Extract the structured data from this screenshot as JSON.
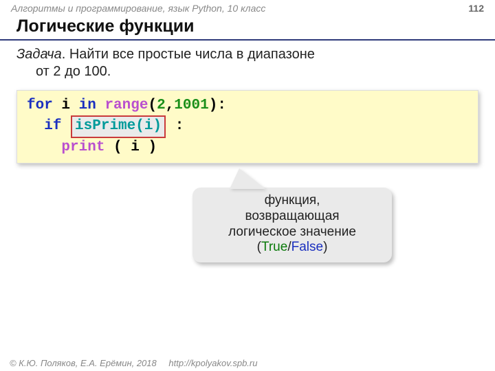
{
  "header": {
    "course": "Алгоритмы и программирование, язык Python, 10 класс",
    "page": "112"
  },
  "title": "Логические функции",
  "task": {
    "label": "Задача",
    "text1": ". Найти все простые числа в диапазоне",
    "text2": "от 2 до 100."
  },
  "code": {
    "kw_for": "for",
    "var_i": " i ",
    "kw_in": "in",
    "fn_range": " range",
    "lp": "(",
    "n1": "2",
    "comma": ",",
    "n2": "1001",
    "rp_colon": "):",
    "indent1": "  ",
    "kw_if": "if",
    "space": " ",
    "call": "isPrime(i)",
    "colon": ":",
    "indent2": "    ",
    "fn_print": "print",
    "print_args": " ( i )"
  },
  "callout": {
    "l1": "функция,",
    "l2": "возвращающая",
    "l3": "логическое значение",
    "lp": "(",
    "true": "True",
    "slash": "/",
    "false": "False",
    "rp": ")"
  },
  "footer": {
    "copyright": "© К.Ю. Поляков, Е.А. Ерёмин, 2018",
    "url": "http://kpolyakov.spb.ru"
  }
}
